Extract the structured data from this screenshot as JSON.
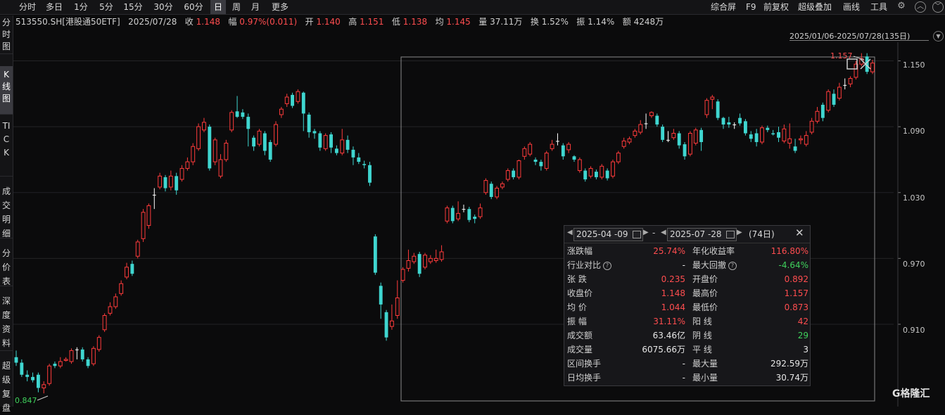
{
  "toolbar": {
    "periods": [
      "分时",
      "多日",
      "1分",
      "5分",
      "15分",
      "30分",
      "60分",
      "日",
      "周",
      "月",
      "更多"
    ],
    "active_period": "日",
    "right_tools": [
      "综合屏",
      "F9",
      "前复权",
      "超级叠加",
      "画线",
      "工具"
    ]
  },
  "sidebar": {
    "tabs": [
      "分时图",
      "K线图",
      "TICK",
      "成交明细",
      "分价表",
      "深度资料",
      "超级复盘"
    ],
    "active": "K线图"
  },
  "quote": {
    "code": "513550.SH[港股通50ETF]",
    "date": "2025/07/28",
    "close_label": "收",
    "close": "1.148",
    "change_label": "幅",
    "change": "0.97%(0.011)",
    "open_label": "开",
    "open": "1.140",
    "high_label": "高",
    "high": "1.151",
    "low_label": "低",
    "low": "1.138",
    "avg_label": "均",
    "avg": "1.145",
    "vol_label": "量",
    "vol": "37.11万",
    "turnover_label": "换",
    "turnover": "1.52%",
    "amplitude_label": "振",
    "amplitude": "1.14%",
    "amount_label": "额",
    "amount": "4248万"
  },
  "range_label": "2025/01/06-2025/07/28(135日)",
  "axis": {
    "ticks": [
      "1.150",
      "1.090",
      "1.030",
      "0.970",
      "0.910"
    ]
  },
  "annotations": {
    "min_label": "0.847",
    "max_label": "1.157"
  },
  "stats_panel": {
    "start_date": "2025-04 -09",
    "end_date": "2025-07 -28",
    "days": "(74日)",
    "dash": "-",
    "rows": [
      {
        "k1": "涨跌幅",
        "v1": "25.74%",
        "c1": "red",
        "k2": "年化收益率",
        "v2": "116.80%",
        "c2": "red",
        "q1": false,
        "q2": false
      },
      {
        "k1": "行业对比",
        "v1": "-",
        "c1": "white",
        "k2": "最大回撤",
        "v2": "-4.64%",
        "c2": "green",
        "q1": true,
        "q2": true
      },
      {
        "k1": "张  跌",
        "v1": "0.235",
        "c1": "red",
        "k2": "开盘价",
        "v2": "0.892",
        "c2": "red",
        "q1": false,
        "q2": false
      },
      {
        "k1": "收盘价",
        "v1": "1.148",
        "c1": "red",
        "k2": "最高价",
        "v2": "1.157",
        "c2": "red",
        "q1": false,
        "q2": false
      },
      {
        "k1": "均  价",
        "v1": "1.044",
        "c1": "red",
        "k2": "最低价",
        "v2": "0.873",
        "c2": "red",
        "q1": false,
        "q2": false
      },
      {
        "k1": "振  幅",
        "v1": "31.11%",
        "c1": "red",
        "k2": "阳  线",
        "v2": "42",
        "c2": "red",
        "q1": false,
        "q2": false
      },
      {
        "k1": "成交额",
        "v1": "63.46亿",
        "c1": "white",
        "k2": "阴  线",
        "v2": "29",
        "c2": "green",
        "q1": false,
        "q2": false
      },
      {
        "k1": "成交量",
        "v1": "6075.66万",
        "c1": "white",
        "k2": "平  线",
        "v2": "3",
        "c2": "white",
        "q1": false,
        "q2": false
      },
      {
        "k1": "区间换手",
        "v1": "-",
        "c1": "white",
        "k2": "最大量",
        "v2": "292.59万",
        "c2": "white",
        "q1": false,
        "q2": false
      },
      {
        "k1": "日均换手",
        "v1": "-",
        "c1": "white",
        "k2": "最小量",
        "v2": "30.74万",
        "c2": "white",
        "q1": false,
        "q2": false
      }
    ]
  },
  "logo": "G格隆汇",
  "colors": {
    "up": "#ff3b3b",
    "down": "#3fd6d0",
    "flat": "#ffffff",
    "bg": "#0b0b0c"
  },
  "chart_data": {
    "type": "candlestick",
    "y_ticks": [
      1.15,
      1.09,
      1.03,
      0.97,
      0.91
    ],
    "ylim": [
      0.835,
      1.167
    ],
    "candles": [
      [
        0.88,
        0.875,
        0.886,
        0.872
      ],
      [
        0.875,
        0.864,
        0.878,
        0.862
      ],
      [
        0.864,
        0.862,
        0.868,
        0.858
      ],
      [
        0.862,
        0.859,
        0.866,
        0.857
      ],
      [
        0.864,
        0.852,
        0.866,
        0.848
      ],
      [
        0.852,
        0.855,
        0.858,
        0.847
      ],
      [
        0.856,
        0.872,
        0.874,
        0.854
      ],
      [
        0.874,
        0.872,
        0.876,
        0.87
      ],
      [
        0.872,
        0.876,
        0.88,
        0.87
      ],
      [
        0.877,
        0.878,
        0.88,
        0.876
      ],
      [
        0.876,
        0.886,
        0.888,
        0.874
      ],
      [
        0.887,
        0.887,
        0.889,
        0.878
      ],
      [
        0.887,
        0.878,
        0.889,
        0.876
      ],
      [
        0.878,
        0.872,
        0.88,
        0.87
      ],
      [
        0.874,
        0.888,
        0.89,
        0.872
      ],
      [
        0.887,
        0.898,
        0.9,
        0.885
      ],
      [
        0.905,
        0.918,
        0.92,
        0.903
      ],
      [
        0.92,
        0.926,
        0.93,
        0.918
      ],
      [
        0.926,
        0.935,
        0.938,
        0.924
      ],
      [
        0.938,
        0.947,
        0.95,
        0.936
      ],
      [
        0.953,
        0.962,
        0.966,
        0.951
      ],
      [
        0.965,
        0.956,
        0.968,
        0.954
      ],
      [
        0.972,
        0.985,
        0.987,
        0.97
      ],
      [
        0.988,
        1.012,
        1.015,
        0.985
      ],
      [
        1.0,
        1.018,
        1.02,
        0.997
      ],
      [
        1.028,
        1.028,
        1.034,
        1.015
      ],
      [
        1.035,
        1.045,
        1.048,
        1.033
      ],
      [
        1.044,
        1.034,
        1.046,
        1.031
      ],
      [
        1.035,
        1.045,
        1.05,
        1.032
      ],
      [
        1.045,
        1.032,
        1.048,
        1.028
      ],
      [
        1.042,
        1.052,
        1.055,
        1.04
      ],
      [
        1.052,
        1.058,
        1.062,
        1.05
      ],
      [
        1.058,
        1.072,
        1.075,
        1.055
      ],
      [
        1.07,
        1.09,
        1.093,
        1.068
      ],
      [
        1.087,
        1.094,
        1.098,
        1.085
      ],
      [
        1.09,
        1.052,
        1.092,
        1.05
      ],
      [
        1.058,
        1.078,
        1.08,
        1.055
      ],
      [
        1.045,
        1.06,
        1.065,
        1.043
      ],
      [
        1.06,
        1.075,
        1.078,
        1.058
      ],
      [
        1.087,
        1.103,
        1.105,
        1.085
      ],
      [
        1.104,
        1.099,
        1.118,
        1.098
      ],
      [
        1.103,
        1.099,
        1.106,
        1.097
      ],
      [
        1.099,
        1.088,
        1.102,
        1.072
      ],
      [
        1.08,
        1.072,
        1.082,
        1.068
      ],
      [
        1.074,
        1.086,
        1.088,
        1.072
      ],
      [
        1.084,
        1.068,
        1.086,
        1.064
      ],
      [
        1.076,
        1.06,
        1.078,
        1.058
      ],
      [
        1.074,
        1.092,
        1.095,
        1.072
      ],
      [
        1.101,
        1.106,
        1.108,
        1.098
      ],
      [
        1.111,
        1.117,
        1.12,
        1.108
      ],
      [
        1.119,
        1.109,
        1.121,
        1.107
      ],
      [
        1.113,
        1.122,
        1.124,
        1.111
      ],
      [
        1.121,
        1.102,
        1.122,
        1.086
      ],
      [
        1.101,
        1.085,
        1.103,
        1.08
      ],
      [
        1.086,
        1.084,
        1.088,
        1.079
      ],
      [
        1.084,
        1.071,
        1.086,
        1.068
      ],
      [
        1.07,
        1.082,
        1.084,
        1.068
      ],
      [
        1.083,
        1.071,
        1.085,
        1.066
      ],
      [
        1.07,
        1.066,
        1.073,
        1.064
      ],
      [
        1.066,
        1.078,
        1.088,
        1.064
      ],
      [
        1.078,
        1.069,
        1.082,
        1.066
      ],
      [
        1.069,
        1.062,
        1.072,
        1.055
      ],
      [
        1.062,
        1.058,
        1.066,
        1.056
      ],
      [
        1.056,
        1.055,
        1.059,
        1.052
      ],
      [
        1.055,
        1.039,
        1.058,
        1.036
      ],
      [
        0.99,
        0.957,
        0.992,
        0.955
      ],
      [
        0.945,
        0.928,
        0.948,
        0.915
      ],
      [
        0.921,
        0.898,
        0.923,
        0.895
      ],
      [
        0.908,
        0.913,
        0.928,
        0.905
      ],
      [
        0.918,
        0.934,
        0.95,
        0.915
      ],
      [
        0.95,
        0.96,
        0.962,
        0.948
      ],
      [
        0.961,
        0.968,
        0.978,
        0.958
      ],
      [
        0.967,
        0.972,
        0.975,
        0.965
      ],
      [
        0.974,
        0.956,
        0.976,
        0.953
      ],
      [
        0.962,
        0.973,
        0.975,
        0.96
      ],
      [
        0.967,
        0.97,
        0.973,
        0.965
      ],
      [
        0.968,
        0.97,
        0.978,
        0.966
      ],
      [
        0.969,
        0.976,
        0.982,
        0.967
      ],
      [
        1.004,
        1.016,
        1.018,
        1.002
      ],
      [
        1.016,
        1.004,
        1.018,
        1.002
      ],
      [
        1.006,
        1.011,
        1.022,
        1.004
      ],
      [
        1.015,
        1.015,
        1.019,
        1.012
      ],
      [
        1.015,
        1.005,
        1.017,
        1.003
      ],
      [
        1.008,
        1.006,
        1.01,
        1.002
      ],
      [
        1.008,
        1.016,
        1.02,
        1.006
      ],
      [
        1.03,
        1.041,
        1.043,
        1.028
      ],
      [
        1.038,
        1.026,
        1.04,
        1.024
      ],
      [
        1.026,
        1.034,
        1.036,
        1.024
      ],
      [
        1.035,
        1.038,
        1.04,
        1.033
      ],
      [
        1.042,
        1.05,
        1.052,
        1.04
      ],
      [
        1.05,
        1.044,
        1.052,
        1.042
      ],
      [
        1.044,
        1.059,
        1.06,
        1.042
      ],
      [
        1.063,
        1.07,
        1.072,
        1.06
      ],
      [
        1.065,
        1.074,
        1.076,
        1.063
      ],
      [
        1.06,
        1.058,
        1.062,
        1.055
      ],
      [
        1.058,
        1.054,
        1.06,
        1.05
      ],
      [
        1.052,
        1.066,
        1.068,
        1.05
      ],
      [
        1.07,
        1.074,
        1.078,
        1.068
      ],
      [
        1.077,
        1.077,
        1.084,
        1.073
      ],
      [
        1.073,
        1.063,
        1.075,
        1.06
      ],
      [
        1.069,
        1.074,
        1.076,
        1.066
      ],
      [
        1.063,
        1.06,
        1.064,
        1.058
      ],
      [
        1.05,
        1.06,
        1.062,
        1.048
      ],
      [
        1.05,
        1.042,
        1.052,
        1.04
      ],
      [
        1.045,
        1.052,
        1.054,
        1.043
      ],
      [
        1.049,
        1.044,
        1.051,
        1.042
      ],
      [
        1.044,
        1.054,
        1.056,
        1.042
      ],
      [
        1.05,
        1.043,
        1.052,
        1.041
      ],
      [
        1.045,
        1.058,
        1.06,
        1.043
      ],
      [
        1.058,
        1.066,
        1.068,
        1.056
      ],
      [
        1.072,
        1.077,
        1.08,
        1.07
      ],
      [
        1.076,
        1.079,
        1.081,
        1.074
      ],
      [
        1.082,
        1.086,
        1.088,
        1.08
      ],
      [
        1.085,
        1.092,
        1.096,
        1.083
      ],
      [
        1.093,
        1.093,
        1.102,
        1.088
      ],
      [
        1.1,
        1.103,
        1.104,
        1.098
      ],
      [
        1.1,
        1.092,
        1.102,
        1.09
      ],
      [
        1.09,
        1.078,
        1.092,
        1.076
      ],
      [
        1.078,
        1.078,
        1.086,
        1.076
      ],
      [
        1.08,
        1.084,
        1.088,
        1.078
      ],
      [
        1.084,
        1.073,
        1.086,
        1.07
      ],
      [
        1.074,
        1.063,
        1.076,
        1.06
      ],
      [
        1.065,
        1.084,
        1.086,
        1.063
      ],
      [
        1.075,
        1.087,
        1.089,
        1.073
      ],
      [
        1.087,
        1.076,
        1.089,
        1.068
      ],
      [
        1.101,
        1.114,
        1.116,
        1.098
      ],
      [
        1.115,
        1.117,
        1.119,
        1.106
      ],
      [
        1.113,
        1.098,
        1.115,
        1.096
      ],
      [
        1.098,
        1.092,
        1.099,
        1.088
      ],
      [
        1.094,
        1.092,
        1.099,
        1.089
      ],
      [
        1.092,
        1.092,
        1.094,
        1.088
      ],
      [
        1.098,
        1.093,
        1.102,
        1.091
      ],
      [
        1.095,
        1.084,
        1.097,
        1.082
      ],
      [
        1.083,
        1.079,
        1.086,
        1.076
      ],
      [
        1.084,
        1.076,
        1.088,
        1.072
      ],
      [
        1.076,
        1.089,
        1.091,
        1.074
      ],
      [
        1.089,
        1.087,
        1.091,
        1.085
      ],
      [
        1.084,
        1.083,
        1.087,
        1.082
      ],
      [
        1.085,
        1.08,
        1.09,
        1.076
      ],
      [
        1.077,
        1.088,
        1.092,
        1.075
      ],
      [
        1.075,
        1.079,
        1.093,
        1.07
      ],
      [
        1.072,
        1.068,
        1.079,
        1.066
      ],
      [
        1.078,
        1.079,
        1.082,
        1.074
      ],
      [
        1.074,
        1.082,
        1.086,
        1.072
      ],
      [
        1.085,
        1.095,
        1.098,
        1.083
      ],
      [
        1.095,
        1.104,
        1.108,
        1.093
      ],
      [
        1.11,
        1.098,
        1.112,
        1.095
      ],
      [
        1.105,
        1.122,
        1.124,
        1.103
      ],
      [
        1.12,
        1.11,
        1.124,
        1.108
      ],
      [
        1.116,
        1.126,
        1.13,
        1.114
      ],
      [
        1.128,
        1.128,
        1.134,
        1.124
      ],
      [
        1.129,
        1.134,
        1.136,
        1.126
      ],
      [
        1.135,
        1.147,
        1.15,
        1.133
      ],
      [
        1.147,
        1.152,
        1.157,
        1.145
      ],
      [
        1.154,
        1.14,
        1.157,
        1.138
      ],
      [
        1.14,
        1.148,
        1.151,
        1.138
      ]
    ]
  }
}
